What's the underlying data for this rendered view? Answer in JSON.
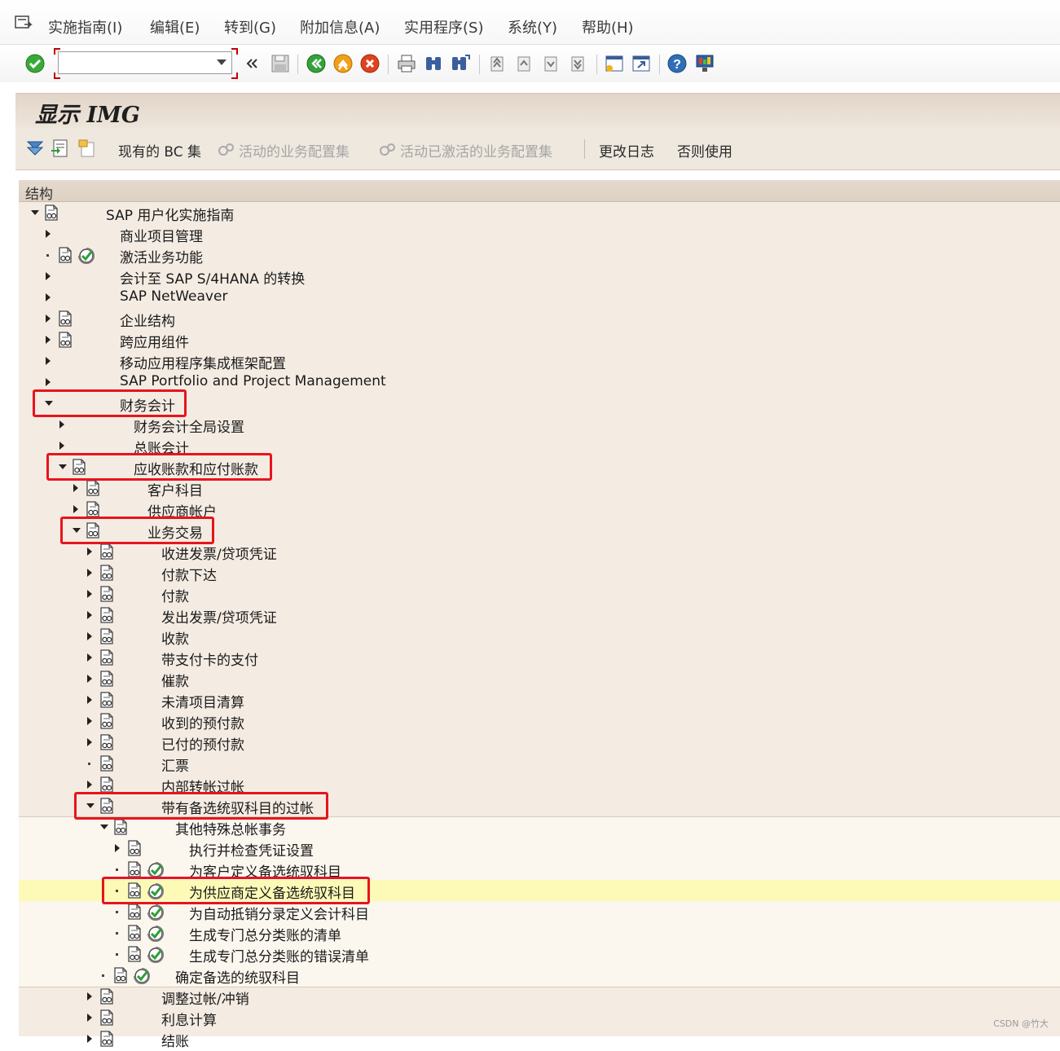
{
  "menubar": {
    "items": [
      "实施指南(I)",
      "编辑(E)",
      "转到(G)",
      "附加信息(A)",
      "实用程序(S)",
      "系统(Y)",
      "帮助(H)"
    ]
  },
  "toolbar": {
    "command_field": {
      "value": "",
      "placeholder": ""
    },
    "icons": [
      "enter-icon",
      "command-field",
      "back-double-icon",
      "save-icon",
      "back-icon",
      "exit-icon",
      "cancel-icon",
      "print-icon",
      "find-icon",
      "find-next-icon",
      "first-page-icon",
      "previous-page-icon",
      "next-page-icon",
      "last-page-icon",
      "create-session-icon",
      "shortcut-icon",
      "help-icon",
      "customize-layout-icon"
    ]
  },
  "title": "显示 IMG",
  "app_toolbar": {
    "buttons": [
      {
        "label": "现有的 BC 集",
        "enabled": true
      },
      {
        "label": "活动的业务配置集",
        "enabled": false
      },
      {
        "label": "活动已激活的业务配置集",
        "enabled": false
      },
      {
        "label": "更改日志",
        "enabled": true
      },
      {
        "label": "否则使用",
        "enabled": true
      }
    ]
  },
  "tree": {
    "header": "结构",
    "rows": [
      {
        "label": "SAP 用户化实施指南",
        "level": 0,
        "toggle": "expanded",
        "doc": true,
        "exec": false
      },
      {
        "label": "商业项目管理",
        "level": 1,
        "toggle": "collapsed",
        "doc": false,
        "exec": false
      },
      {
        "label": "激活业务功能",
        "level": 1,
        "toggle": "leaf",
        "doc": true,
        "exec": true
      },
      {
        "label": "会计至 SAP S/4HANA 的转换",
        "level": 1,
        "toggle": "collapsed",
        "doc": false,
        "exec": false
      },
      {
        "label": "SAP NetWeaver",
        "level": 1,
        "toggle": "collapsed",
        "doc": false,
        "exec": false
      },
      {
        "label": "企业结构",
        "level": 1,
        "toggle": "collapsed",
        "doc": true,
        "exec": false
      },
      {
        "label": "跨应用组件",
        "level": 1,
        "toggle": "collapsed",
        "doc": true,
        "exec": false
      },
      {
        "label": "移动应用程序集成框架配置",
        "level": 1,
        "toggle": "collapsed",
        "doc": false,
        "exec": false
      },
      {
        "label": "SAP Portfolio and Project Management",
        "level": 1,
        "toggle": "collapsed",
        "doc": false,
        "exec": false
      },
      {
        "label": "财务会计",
        "level": 1,
        "toggle": "expanded",
        "doc": false,
        "exec": false
      },
      {
        "label": "财务会计全局设置",
        "level": 2,
        "toggle": "collapsed",
        "doc": false,
        "exec": false
      },
      {
        "label": "总账会计",
        "level": 2,
        "toggle": "collapsed",
        "doc": false,
        "exec": false
      },
      {
        "label": "应收账款和应付账款",
        "level": 2,
        "toggle": "expanded",
        "doc": true,
        "exec": false
      },
      {
        "label": "客户科目",
        "level": 3,
        "toggle": "collapsed",
        "doc": true,
        "exec": false
      },
      {
        "label": "供应商帐户",
        "level": 3,
        "toggle": "collapsed",
        "doc": true,
        "exec": false
      },
      {
        "label": "业务交易",
        "level": 3,
        "toggle": "expanded",
        "doc": true,
        "exec": false
      },
      {
        "label": "收进发票/贷项凭证",
        "level": 4,
        "toggle": "collapsed",
        "doc": true,
        "exec": false
      },
      {
        "label": "付款下达",
        "level": 4,
        "toggle": "collapsed",
        "doc": true,
        "exec": false
      },
      {
        "label": "付款",
        "level": 4,
        "toggle": "collapsed",
        "doc": true,
        "exec": false
      },
      {
        "label": "发出发票/贷项凭证",
        "level": 4,
        "toggle": "collapsed",
        "doc": true,
        "exec": false
      },
      {
        "label": "收款",
        "level": 4,
        "toggle": "collapsed",
        "doc": true,
        "exec": false
      },
      {
        "label": "带支付卡的支付",
        "level": 4,
        "toggle": "collapsed",
        "doc": true,
        "exec": false
      },
      {
        "label": "催款",
        "level": 4,
        "toggle": "collapsed",
        "doc": true,
        "exec": false
      },
      {
        "label": "未清项目清算",
        "level": 4,
        "toggle": "collapsed",
        "doc": true,
        "exec": false
      },
      {
        "label": "收到的预付款",
        "level": 4,
        "toggle": "collapsed",
        "doc": true,
        "exec": false
      },
      {
        "label": "已付的预付款",
        "level": 4,
        "toggle": "collapsed",
        "doc": true,
        "exec": false
      },
      {
        "label": "汇票",
        "level": 4,
        "toggle": "leaf",
        "doc": true,
        "exec": false
      },
      {
        "label": "内部转帐过帐",
        "level": 4,
        "toggle": "collapsed",
        "doc": true,
        "exec": false
      },
      {
        "label": "带有备选统驭科目的过帐",
        "level": 4,
        "toggle": "expanded",
        "doc": true,
        "exec": false
      },
      {
        "label": "其他特殊总帐事务",
        "level": 5,
        "toggle": "expanded",
        "doc": true,
        "exec": false
      },
      {
        "label": "执行并检查凭证设置",
        "level": 6,
        "toggle": "collapsed",
        "doc": true,
        "exec": false
      },
      {
        "label": "为客户定义备选统驭科目",
        "level": 6,
        "toggle": "leaf",
        "doc": true,
        "exec": true
      },
      {
        "label": "为供应商定义备选统驭科目",
        "level": 6,
        "toggle": "leaf",
        "doc": true,
        "exec": true,
        "selected": true
      },
      {
        "label": "为自动抵销分录定义会计科目",
        "level": 6,
        "toggle": "leaf",
        "doc": true,
        "exec": true
      },
      {
        "label": "生成专门总分类账的清单",
        "level": 6,
        "toggle": "leaf",
        "doc": true,
        "exec": true
      },
      {
        "label": "生成专门总分类账的错误清单",
        "level": 6,
        "toggle": "leaf",
        "doc": true,
        "exec": true
      },
      {
        "label": "确定备选的统驭科目",
        "level": 5,
        "toggle": "leaf",
        "doc": true,
        "exec": true
      },
      {
        "label": "调整过帐/冲销",
        "level": 4,
        "toggle": "collapsed",
        "doc": true,
        "exec": false
      },
      {
        "label": "利息计算",
        "level": 4,
        "toggle": "collapsed",
        "doc": true,
        "exec": false
      },
      {
        "label": "结账",
        "level": 4,
        "toggle": "collapsed",
        "doc": true,
        "exec": false
      }
    ]
  },
  "colors": {
    "tree_bg": "#f4ece3",
    "sub_bg": "#fbf6ee",
    "selection": "#fdfab8",
    "highlight_border": "#e8141c"
  },
  "watermark": "CSDN @竹大"
}
